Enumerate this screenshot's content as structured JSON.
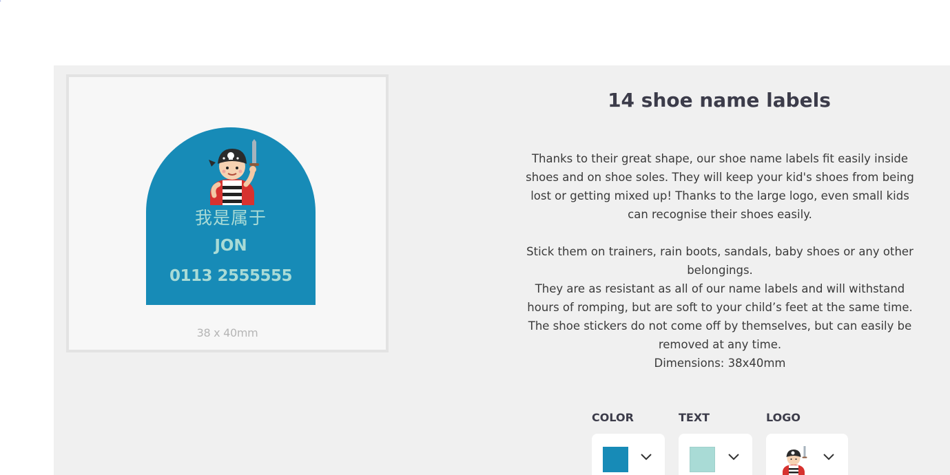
{
  "product": {
    "title": "14 shoe name labels",
    "description": [
      "Thanks to their great shape, our shoe name labels fit easily inside shoes and on shoe soles. They will keep your kid's shoes from being lost or getting mixed up! Thanks to the large logo, even small kids can recognise their shoes easily.",
      "Stick them on trainers, rain boots, sandals, baby shoes or any other belongings.",
      "They are as resistant as all of our name labels and will withstand hours of romping, but are soft to your child’s feet at the same time. The shoe stickers do not come off by themselves, but can easily be removed at any time.",
      "Dimensions: 38x40mm"
    ]
  },
  "preview": {
    "line1": "我是属于",
    "line2": "JON",
    "line3": "0113 2555555",
    "dimensions": "38 x 40mm",
    "logo_icon": "pirate-icon",
    "label_color": "#178bb7",
    "text_color": "#a9dbd6"
  },
  "options": {
    "color": {
      "label": "COLOR",
      "value": "#178bb7"
    },
    "text": {
      "label": "TEXT",
      "value": "#a9dbd6"
    },
    "logo": {
      "label": "LOGO",
      "value": "pirate-icon"
    }
  }
}
